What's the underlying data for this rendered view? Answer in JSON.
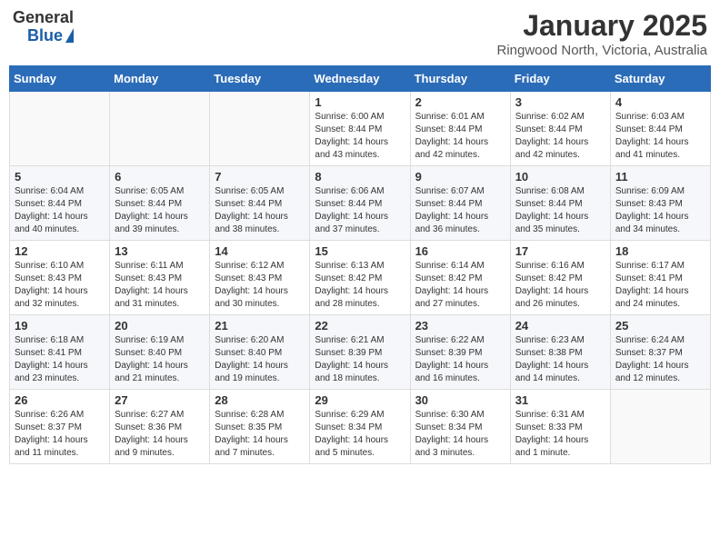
{
  "logo": {
    "general": "General",
    "blue": "Blue"
  },
  "title": "January 2025",
  "subtitle": "Ringwood North, Victoria, Australia",
  "weekdays": [
    "Sunday",
    "Monday",
    "Tuesday",
    "Wednesday",
    "Thursday",
    "Friday",
    "Saturday"
  ],
  "weeks": [
    [
      {
        "day": "",
        "info": ""
      },
      {
        "day": "",
        "info": ""
      },
      {
        "day": "",
        "info": ""
      },
      {
        "day": "1",
        "info": "Sunrise: 6:00 AM\nSunset: 8:44 PM\nDaylight: 14 hours\nand 43 minutes."
      },
      {
        "day": "2",
        "info": "Sunrise: 6:01 AM\nSunset: 8:44 PM\nDaylight: 14 hours\nand 42 minutes."
      },
      {
        "day": "3",
        "info": "Sunrise: 6:02 AM\nSunset: 8:44 PM\nDaylight: 14 hours\nand 42 minutes."
      },
      {
        "day": "4",
        "info": "Sunrise: 6:03 AM\nSunset: 8:44 PM\nDaylight: 14 hours\nand 41 minutes."
      }
    ],
    [
      {
        "day": "5",
        "info": "Sunrise: 6:04 AM\nSunset: 8:44 PM\nDaylight: 14 hours\nand 40 minutes."
      },
      {
        "day": "6",
        "info": "Sunrise: 6:05 AM\nSunset: 8:44 PM\nDaylight: 14 hours\nand 39 minutes."
      },
      {
        "day": "7",
        "info": "Sunrise: 6:05 AM\nSunset: 8:44 PM\nDaylight: 14 hours\nand 38 minutes."
      },
      {
        "day": "8",
        "info": "Sunrise: 6:06 AM\nSunset: 8:44 PM\nDaylight: 14 hours\nand 37 minutes."
      },
      {
        "day": "9",
        "info": "Sunrise: 6:07 AM\nSunset: 8:44 PM\nDaylight: 14 hours\nand 36 minutes."
      },
      {
        "day": "10",
        "info": "Sunrise: 6:08 AM\nSunset: 8:44 PM\nDaylight: 14 hours\nand 35 minutes."
      },
      {
        "day": "11",
        "info": "Sunrise: 6:09 AM\nSunset: 8:43 PM\nDaylight: 14 hours\nand 34 minutes."
      }
    ],
    [
      {
        "day": "12",
        "info": "Sunrise: 6:10 AM\nSunset: 8:43 PM\nDaylight: 14 hours\nand 32 minutes."
      },
      {
        "day": "13",
        "info": "Sunrise: 6:11 AM\nSunset: 8:43 PM\nDaylight: 14 hours\nand 31 minutes."
      },
      {
        "day": "14",
        "info": "Sunrise: 6:12 AM\nSunset: 8:43 PM\nDaylight: 14 hours\nand 30 minutes."
      },
      {
        "day": "15",
        "info": "Sunrise: 6:13 AM\nSunset: 8:42 PM\nDaylight: 14 hours\nand 28 minutes."
      },
      {
        "day": "16",
        "info": "Sunrise: 6:14 AM\nSunset: 8:42 PM\nDaylight: 14 hours\nand 27 minutes."
      },
      {
        "day": "17",
        "info": "Sunrise: 6:16 AM\nSunset: 8:42 PM\nDaylight: 14 hours\nand 26 minutes."
      },
      {
        "day": "18",
        "info": "Sunrise: 6:17 AM\nSunset: 8:41 PM\nDaylight: 14 hours\nand 24 minutes."
      }
    ],
    [
      {
        "day": "19",
        "info": "Sunrise: 6:18 AM\nSunset: 8:41 PM\nDaylight: 14 hours\nand 23 minutes."
      },
      {
        "day": "20",
        "info": "Sunrise: 6:19 AM\nSunset: 8:40 PM\nDaylight: 14 hours\nand 21 minutes."
      },
      {
        "day": "21",
        "info": "Sunrise: 6:20 AM\nSunset: 8:40 PM\nDaylight: 14 hours\nand 19 minutes."
      },
      {
        "day": "22",
        "info": "Sunrise: 6:21 AM\nSunset: 8:39 PM\nDaylight: 14 hours\nand 18 minutes."
      },
      {
        "day": "23",
        "info": "Sunrise: 6:22 AM\nSunset: 8:39 PM\nDaylight: 14 hours\nand 16 minutes."
      },
      {
        "day": "24",
        "info": "Sunrise: 6:23 AM\nSunset: 8:38 PM\nDaylight: 14 hours\nand 14 minutes."
      },
      {
        "day": "25",
        "info": "Sunrise: 6:24 AM\nSunset: 8:37 PM\nDaylight: 14 hours\nand 12 minutes."
      }
    ],
    [
      {
        "day": "26",
        "info": "Sunrise: 6:26 AM\nSunset: 8:37 PM\nDaylight: 14 hours\nand 11 minutes."
      },
      {
        "day": "27",
        "info": "Sunrise: 6:27 AM\nSunset: 8:36 PM\nDaylight: 14 hours\nand 9 minutes."
      },
      {
        "day": "28",
        "info": "Sunrise: 6:28 AM\nSunset: 8:35 PM\nDaylight: 14 hours\nand 7 minutes."
      },
      {
        "day": "29",
        "info": "Sunrise: 6:29 AM\nSunset: 8:34 PM\nDaylight: 14 hours\nand 5 minutes."
      },
      {
        "day": "30",
        "info": "Sunrise: 6:30 AM\nSunset: 8:34 PM\nDaylight: 14 hours\nand 3 minutes."
      },
      {
        "day": "31",
        "info": "Sunrise: 6:31 AM\nSunset: 8:33 PM\nDaylight: 14 hours\nand 1 minute."
      },
      {
        "day": "",
        "info": ""
      }
    ]
  ]
}
